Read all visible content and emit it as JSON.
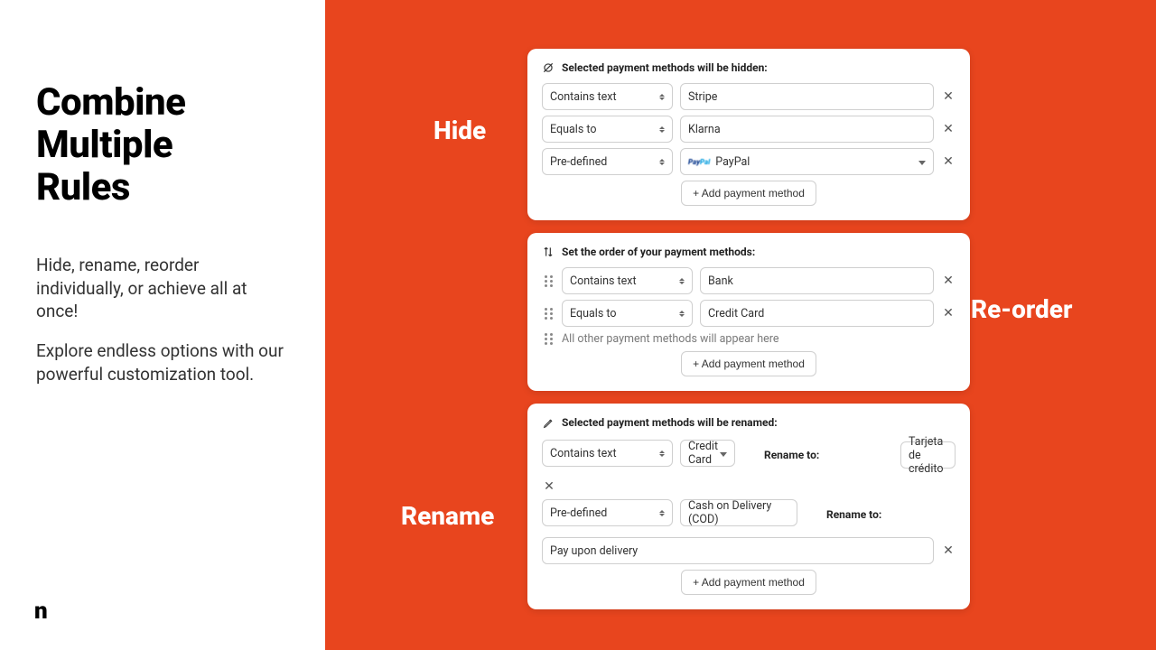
{
  "left": {
    "headline_l1": "Combine",
    "headline_l2": "Multiple",
    "headline_l3": "Rules",
    "copy_p1": "Hide, rename, reorder individually, or achieve all at once!",
    "copy_p2": "Explore endless options with our powerful customization tool.",
    "logo_glyph": "n"
  },
  "labels": {
    "hide": "Hide",
    "reorder": "Re-order",
    "rename": "Rename"
  },
  "hide_card": {
    "title": "Selected payment methods will be hidden:",
    "rows": [
      {
        "condition": "Contains text",
        "value": "Stripe",
        "kind": "text"
      },
      {
        "condition": "Equals to",
        "value": "Klarna",
        "kind": "text"
      },
      {
        "condition": "Pre-defined",
        "value": "PayPal",
        "kind": "paypal"
      }
    ],
    "add_label": "+ Add payment method"
  },
  "reorder_card": {
    "title": "Set the order of your payment methods:",
    "rows": [
      {
        "condition": "Contains text",
        "value": "Bank"
      },
      {
        "condition": "Equals to",
        "value": "Credit Card"
      }
    ],
    "rest_label": "All other payment methods will appear here",
    "add_label": "+ Add payment method"
  },
  "rename_card": {
    "title": "Selected payment methods will be renamed:",
    "rename_to_label": "Rename to:",
    "rows": [
      {
        "condition": "Contains text",
        "value": "Credit Card",
        "rename": "Tarjeta de crédito",
        "kind": "select"
      },
      {
        "condition": "Pre-defined",
        "value": "Cash on Delivery (COD)",
        "rename": "Pay upon delivery",
        "kind": "text"
      }
    ],
    "add_label": "+ Add payment method"
  }
}
